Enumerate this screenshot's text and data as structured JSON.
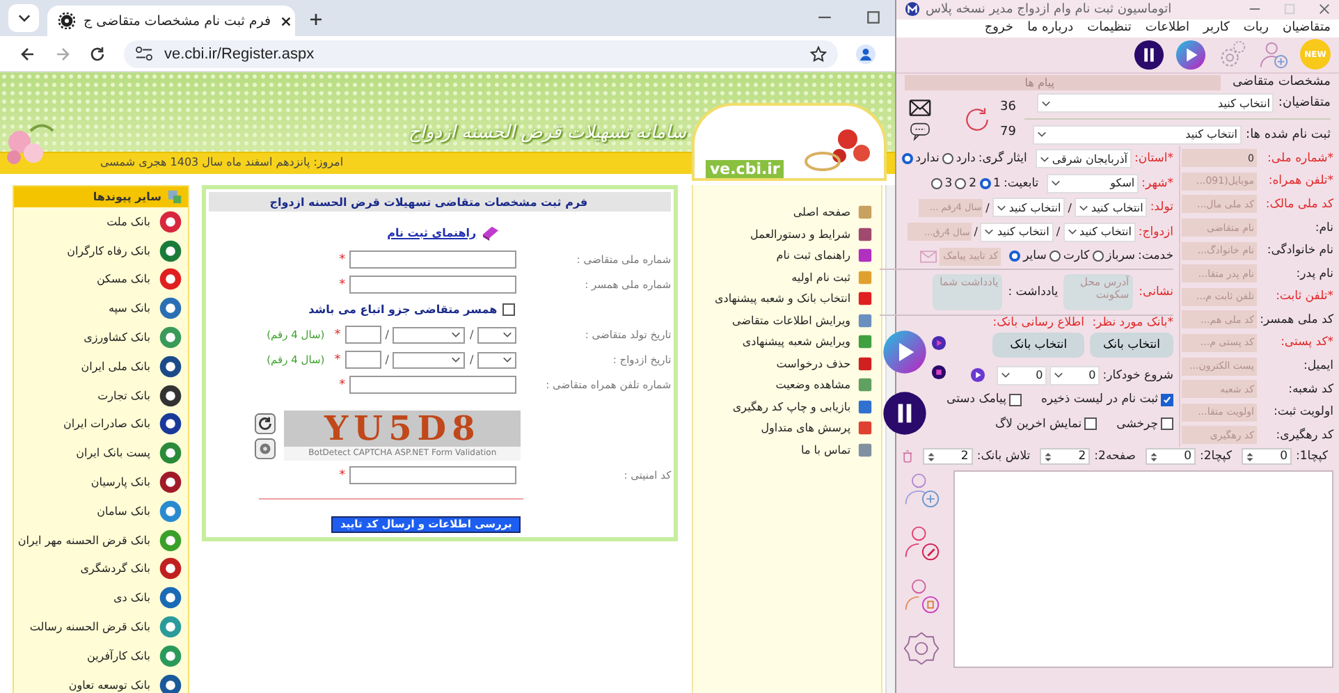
{
  "browser": {
    "tab_title": "فرم ثبت نام مشخصات متقاضی ج",
    "url": "ve.cbi.ir/Register.aspx"
  },
  "site": {
    "banner_title": "سامانه تسهیلات قرض الحسنه ازدواج",
    "logo_text": "ve.cbi.ir",
    "date": "امروز: پانزدهم اسفند ماه سال 1403 هجری شمسی"
  },
  "links": {
    "title": "سایر پیوندها",
    "items": [
      {
        "label": "بانک ملت",
        "color": "#d7263d"
      },
      {
        "label": "بانک رفاه کارگران",
        "color": "#1a7a3a"
      },
      {
        "label": "بانک مسکن",
        "color": "#e02020"
      },
      {
        "label": "بانک سپه",
        "color": "#2a6fb5"
      },
      {
        "label": "بانک کشاورزی",
        "color": "#3a9a5a"
      },
      {
        "label": "بانک ملی ایران",
        "color": "#1a4a8a"
      },
      {
        "label": "بانک تجارت",
        "color": "#333333"
      },
      {
        "label": "بانک صادرات ایران",
        "color": "#1a3a9a"
      },
      {
        "label": "پست بانک ایران",
        "color": "#2a8a3a"
      },
      {
        "label": "بانک پارسیان",
        "color": "#a01a2a"
      },
      {
        "label": "بانک سامان",
        "color": "#2a8ad0"
      },
      {
        "label": "بانک قرض الحسنه مهر ایران",
        "color": "#3aa02a"
      },
      {
        "label": "بانک گردشگری",
        "color": "#c02020"
      },
      {
        "label": "بانک دی",
        "color": "#1a6ab5"
      },
      {
        "label": "بانک قرض الحسنه رسالت",
        "color": "#2a9a9a"
      },
      {
        "label": "بانک کارآفرین",
        "color": "#2a9a5a"
      },
      {
        "label": "بانک توسعه تعاون",
        "color": "#1a5a9a"
      }
    ]
  },
  "form": {
    "title": "فرم ثبت مشخصات متقاضی تسهیلات قرض الحسنه ازدواج",
    "guide_link": "راهنمای ثبت نام",
    "fields": [
      {
        "kind": "text",
        "label": "شماره ملی متقاضی :",
        "mark": "*"
      },
      {
        "kind": "text",
        "label": "شماره ملی همسر :",
        "mark": "*"
      },
      {
        "kind": "checkbox",
        "label": "همسر متقاضی جزو اتباع می باشد",
        "checked": false
      },
      {
        "kind": "date",
        "label": "تاریخ تولد متقاضی :",
        "mark": "*",
        "separators": [
          "/",
          "/"
        ],
        "hint": "(سال 4 رقم)"
      },
      {
        "kind": "date",
        "label": "تاریخ ازدواج :",
        "mark": "*",
        "separators": [
          "/",
          "/"
        ],
        "hint": "(سال 4 رقم)"
      },
      {
        "kind": "text",
        "label": "شماره تلفن همراه متقاضی :",
        "mark": "*"
      }
    ],
    "captcha": {
      "code": "YU5D8",
      "caption": "BotDetect CAPTCHA ASP.NET Form Validation"
    },
    "security": {
      "label": "کد امنیتی :",
      "mark": "*"
    },
    "submit": "بررسی اطلاعات و ارسال کد تایید"
  },
  "menu": {
    "items": [
      {
        "label": "صفحه اصلی",
        "color": "#c8a060"
      },
      {
        "label": "شرایط و دستورالعمل",
        "color": "#a04a70"
      },
      {
        "label": "راهنمای ثبت نام",
        "color": "#b030c0"
      },
      {
        "label": "ثبت نام اولیه",
        "color": "#e0a030"
      },
      {
        "label": "انتخاب بانک و شعبه پیشنهادی",
        "color": "#e02020"
      },
      {
        "label": "ویرایش اطلاعات متقاضی",
        "color": "#6a90c0"
      },
      {
        "label": "ویرایش شعبه پیشنهادی",
        "color": "#40a040"
      },
      {
        "label": "حذف درخواست",
        "color": "#d02020"
      },
      {
        "label": "مشاهده وضعیت",
        "color": "#60a060"
      },
      {
        "label": "بازیابی و چاپ کد رهگیری",
        "color": "#3070d0"
      },
      {
        "label": "پرسش های متداول",
        "color": "#e04030"
      },
      {
        "label": "تماس با ما",
        "color": "#8090a0"
      }
    ]
  },
  "app": {
    "title": "اتوماسیون ثبت نام وام ازدواج مدیر نسخه پلاس",
    "menu": [
      "متقاضیان",
      "ربات",
      "کاربر",
      "اطلاعات",
      "تنظیمات",
      "درباره ما",
      "خروج"
    ],
    "new_badge": "NEW",
    "section_title": "مشخصات متقاضی",
    "messages_label": "پیام ها",
    "counters": [
      "36",
      "79"
    ],
    "applicants": {
      "label": "متقاضیان:",
      "value": "انتخاب کنید"
    },
    "registered": {
      "label": "ثبت نام شده ها:",
      "value": "انتخاب کنید"
    },
    "fields": [
      {
        "label": "*شماره ملی:",
        "value": "0",
        "required": true
      },
      {
        "label": "*تلفن همراه:",
        "placeholder": "موبایل(091...",
        "required": true
      },
      {
        "label": "کد ملی مالک:",
        "placeholder": "کد ملی مال...",
        "required": true
      },
      {
        "label": "نام:",
        "placeholder": "نام متقاضی",
        "required": false
      },
      {
        "label": "نام خانوادگی:",
        "placeholder": "نام خانوادگ...",
        "required": false
      },
      {
        "label": "نام پدر:",
        "placeholder": "نام پدر متقا...",
        "required": false
      },
      {
        "label": "*تلفن ثابت:",
        "placeholder": "تلفن ثابت م...",
        "required": true
      },
      {
        "label": "کد ملی همسر:",
        "placeholder": "کد ملی هم...",
        "required": false
      },
      {
        "label": "*کد پستی:",
        "placeholder": "کد پستی م...",
        "required": true
      },
      {
        "label": "ایمیل:",
        "placeholder": "پست الکترون...",
        "required": false
      },
      {
        "label": "کد شعبه:",
        "placeholder": "کد شعبه",
        "required": false
      },
      {
        "label": "اولویت ثبت:",
        "placeholder": "اولویت متقا...",
        "required": false
      },
      {
        "label": "کد رهگیری:",
        "placeholder": "کد رهگیری",
        "required": false
      }
    ],
    "province": {
      "label": "*استان:",
      "value": "آذربایجان شرقی"
    },
    "veteran": {
      "label": "ایثار گری:",
      "options": [
        {
          "label": "دارد",
          "selected": false
        },
        {
          "label": "ندارد",
          "selected": true
        }
      ]
    },
    "city": {
      "label": "*شهر:",
      "value": "اسکو"
    },
    "nationality": {
      "label": "تابعیت:",
      "options": [
        {
          "label": "1",
          "selected": true
        },
        {
          "label": "2",
          "selected": false
        },
        {
          "label": "3",
          "selected": false
        }
      ]
    },
    "birth": {
      "label": "تولد:",
      "day": "انتخاب کنید",
      "month": "انتخاب کنید",
      "year_placeholder": "سال 4رقم ...",
      "separators": [
        "/",
        "/"
      ]
    },
    "marriage": {
      "label": "ازدواج:",
      "day": "انتخاب کنید",
      "month": "انتخاب کنید",
      "year_placeholder": "سال 4رق...",
      "separators": [
        "/",
        "/"
      ]
    },
    "military": {
      "label": "خدمت:",
      "options": [
        {
          "label": "سرباز",
          "selected": false
        },
        {
          "label": "کارت",
          "selected": false
        },
        {
          "label": "سایر",
          "selected": true
        }
      ]
    },
    "sms_code": {
      "placeholder": "کد تایید پیامک"
    },
    "address": {
      "label": "نشانی:",
      "placeholder": "آدرس محل سکونت"
    },
    "note": {
      "label": "یادداشت :",
      "placeholder": "یادداشت شما"
    },
    "bank": {
      "label": "*بانک مورد نظر:",
      "button": "انتخاب بانک"
    },
    "notify_bank": {
      "label": "اطلاع رسانی بانک:",
      "button": "انتخاب بانک"
    },
    "autostart": {
      "label": "شروع خودکار:",
      "values": [
        "0",
        "0"
      ]
    },
    "checks": [
      {
        "label": "ثبت نام در لیست ذخیره",
        "checked": true
      },
      {
        "label": "پیامک دستی",
        "checked": false
      },
      {
        "label": "چرخشی",
        "checked": false
      },
      {
        "label": "نمایش اخرین لاگ",
        "checked": false
      }
    ],
    "spinners": [
      {
        "label": "کپچا1:",
        "value": "0"
      },
      {
        "label": "کپچا2:",
        "value": "0"
      },
      {
        "label": "صفحه2:",
        "value": "2"
      },
      {
        "label": "تلاش بانک:",
        "value": "2"
      }
    ]
  }
}
